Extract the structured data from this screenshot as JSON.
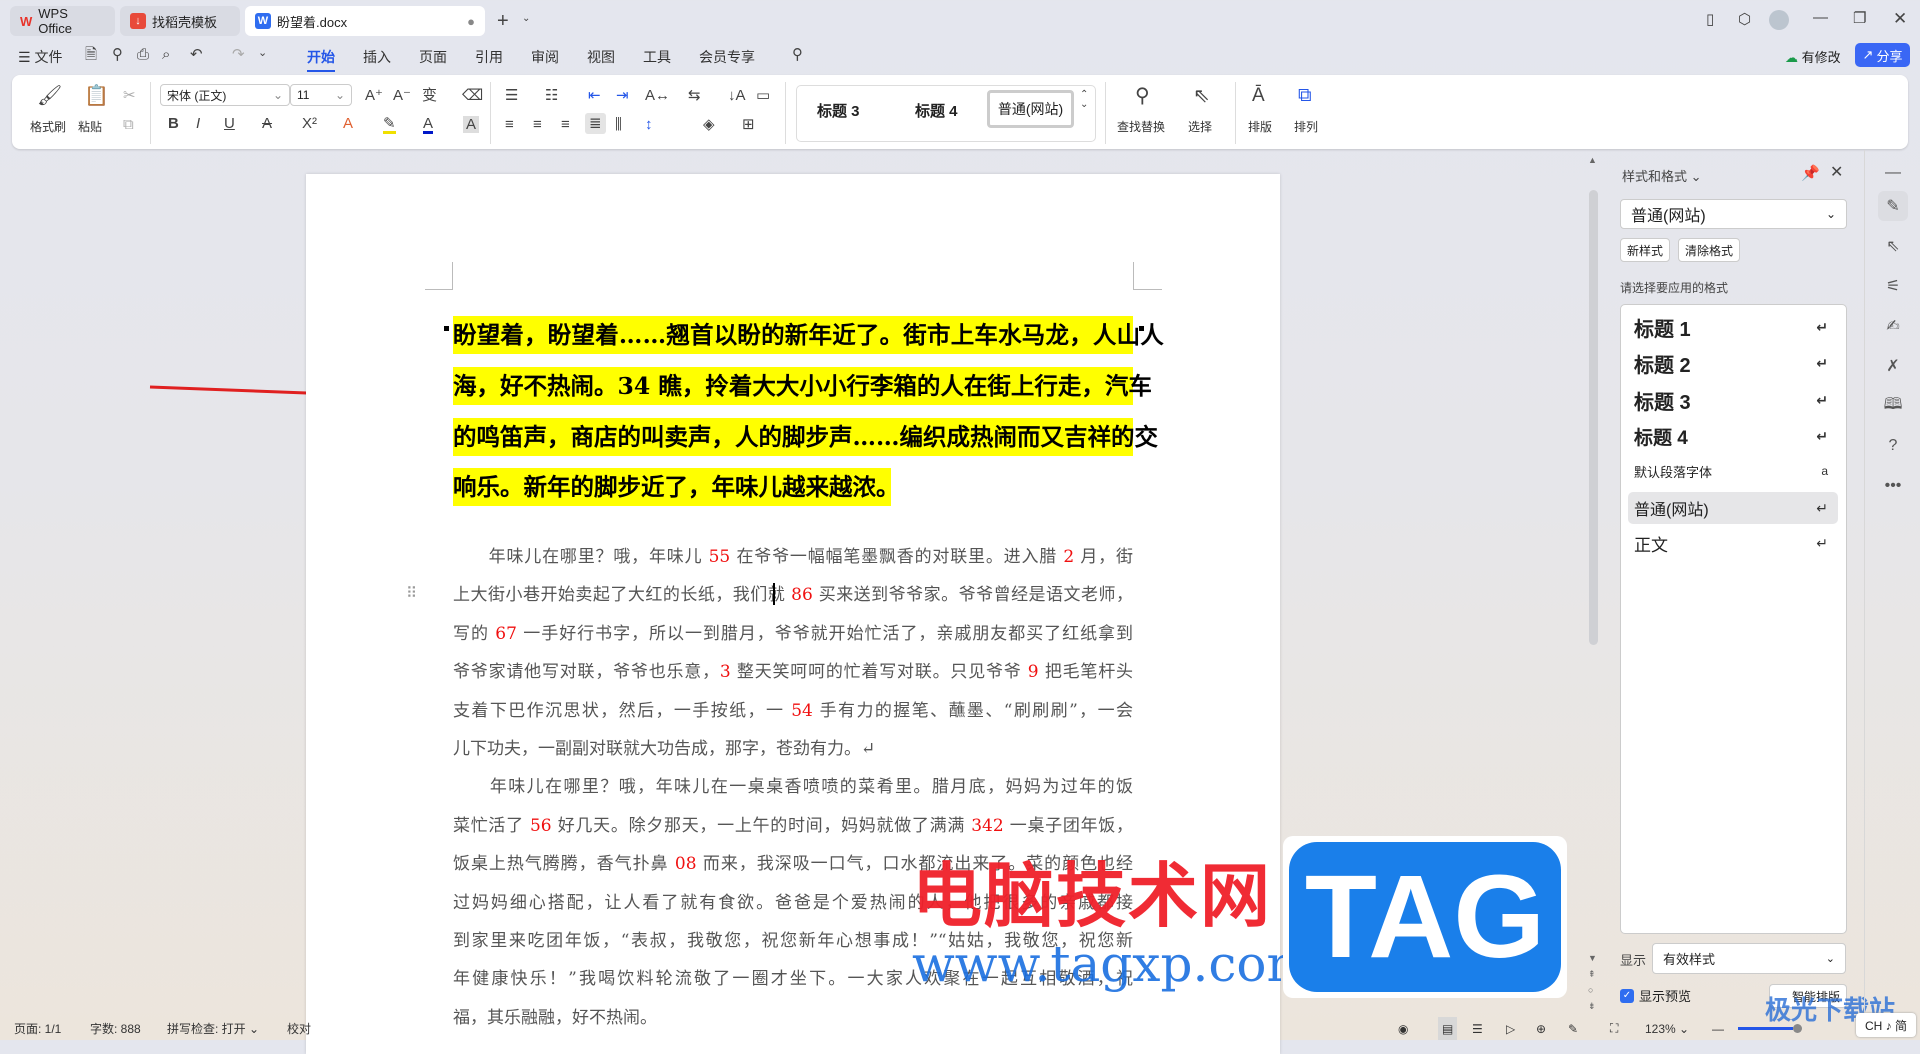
{
  "tabs": [
    {
      "label": "WPS Office"
    },
    {
      "label": "找稻壳模板"
    },
    {
      "label": "盼望着.docx"
    }
  ],
  "menu": {
    "file": "文件",
    "items": [
      "开始",
      "插入",
      "页面",
      "引用",
      "审阅",
      "视图",
      "工具",
      "会员专享"
    ],
    "modified": "有修改",
    "share": "分享"
  },
  "ribbon": {
    "format_painter": "格式刷",
    "paste": "粘贴",
    "font_name": "宋体 (正文)",
    "font_size": "11",
    "styles": [
      "标题 3",
      "标题 4",
      "普通(网站)"
    ],
    "find_replace": "查找替换",
    "select": "选择",
    "layout": "排版",
    "arrange": "排列"
  },
  "document": {
    "highlight_lines": [
      "盼望着，盼望着……翘首以盼的新年近了。街市上车水马龙，人山人",
      "海，好不热闹。34 瞧，拎着大大小小行李箱的人在街上行走，汽车",
      "的鸣笛声，商店的叫卖声，人的脚步声……编织成热闹而又吉祥的交",
      "响乐。新年的脚步近了，年味儿越来越浓。"
    ],
    "para1": [
      [
        "　　年味儿在哪里？哦，年味儿 ",
        "55",
        " 在爷爷一幅幅笔墨飘香的对联里。进入腊 ",
        "2",
        " 月，街"
      ],
      [
        "上大街小巷开始卖起了大红的长纸，我们就 ",
        "86",
        " 买来送到爷爷家。爷爷曾经是语文老师，"
      ],
      [
        "写的 ",
        "67",
        " 一手好行书字，所以一到腊月，爷爷就开始忙活了，亲戚朋友都买了红纸拿到"
      ],
      [
        "爷爷家请他写对联，爷爷也乐意，",
        "3",
        " 整天笑呵呵的忙着写对联。只见爷爷 ",
        "9",
        " 把毛笔杆头"
      ],
      [
        "支着下巴作沉思状，然后，一手按纸，一 ",
        "54",
        " 手有力的握笔、蘸墨、“刷刷刷”，一会"
      ],
      [
        "儿下功夫，一副副对联就大功告成，那字，苍劲有力。↵"
      ]
    ],
    "para2": [
      [
        "　　年味儿在哪里？哦，年味儿在一桌桌香喷喷的菜肴里。腊月底，妈妈为过年的饭"
      ],
      [
        "菜忙活了 ",
        "56",
        " 好几天。除夕那天，一上午的时间，妈妈就做了满满 ",
        "342",
        " 一桌子团年饭，"
      ],
      [
        "饭桌上热气腾腾，香气扑鼻 ",
        "08",
        " 而来，我深吸一口气，口水都流出来了。菜的颜色也经"
      ],
      [
        "过妈妈细心搭配，让人看了就有食欲。爸爸是个爱热闹的人，他把很多的亲戚都接"
      ],
      [
        "到家里来吃团年饭，“表叔，我敬您，祝您新年心想事成！”“姑姑，我敬您，祝您新"
      ],
      [
        "年健康快乐！”我喝饮料轮流敬了一圈才坐下。一大家人欢聚在一起互相敬酒，祝"
      ],
      [
        "福，其乐融融，好不热闹。"
      ]
    ]
  },
  "panel": {
    "title": "样式和格式",
    "current_style": "普通(网站)",
    "new_style": "新样式",
    "clear_format": "清除格式",
    "apply_label": "请选择要应用的格式",
    "styles": [
      "标题 1",
      "标题 2",
      "标题 3",
      "标题 4",
      "默认段落字体",
      "普通(网站)",
      "正文"
    ],
    "show_label": "显示",
    "show_value": "有效样式",
    "preview_label": "显示预览",
    "smart_layout": "智能排版"
  },
  "status": {
    "page": "页面: 1/1",
    "words": "字数: 888",
    "spell": "拼写检查: 打开",
    "proof": "校对",
    "zoom": "123%",
    "ime": "CH ♪ 简"
  },
  "watermarks": {
    "red": "电脑技术网",
    "url": "www.tagxp.com",
    "tag": "TAG",
    "corner": "极光下载站"
  },
  "colors": {
    "accent": "#2456e8",
    "highlight": "#ffff00",
    "number_red": "#f01010",
    "tag_blue": "#1a7fea"
  }
}
